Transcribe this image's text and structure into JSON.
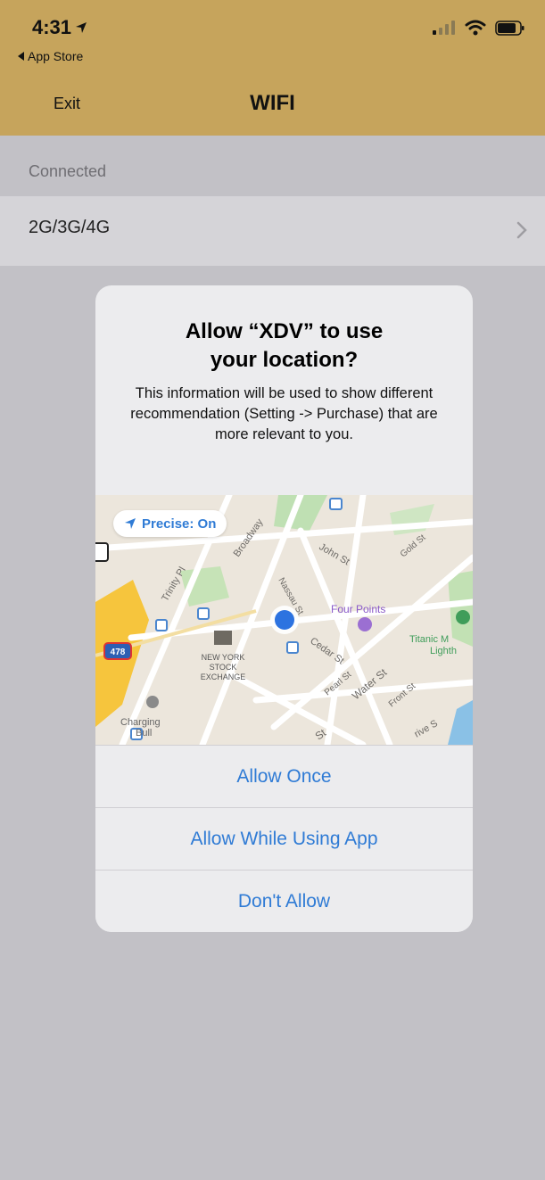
{
  "status_bar": {
    "time": "4:31",
    "back_app": "App Store"
  },
  "nav": {
    "exit_label": "Exit",
    "title": "WIFI"
  },
  "list": {
    "section_header": "Connected",
    "row_label": "2G/3G/4G"
  },
  "alert": {
    "title_line1": "Allow “XDV” to use",
    "title_line2": "your location?",
    "message": "This information will be used to show different recommendation (Setting -> Purchase) that are more relevant to you.",
    "map": {
      "precise_label": "Precise: On",
      "labels": {
        "broadway": "Broadway",
        "trinity": "Trinity Pl",
        "nassau": "Nassau St",
        "john": "John St",
        "gold": "Gold St",
        "four_points": "Four Points",
        "titanic": "Titanic M",
        "lighth": "Lighth",
        "cedar": "Cedar St",
        "pearl": "Pearl St",
        "water": "Water St",
        "front": "Front St",
        "nyse1": "NEW YORK",
        "nyse2": "STOCK",
        "nyse3": "EXCHANGE",
        "charging": "Charging",
        "bull": "Bull",
        "route": "478",
        "st": "St",
        "drive": "rive S"
      }
    },
    "buttons": {
      "once": "Allow Once",
      "while_using": "Allow While Using App",
      "dont": "Don't Allow"
    }
  },
  "colors": {
    "header_bg": "#c6a45c",
    "page_bg": "#c2c1c6",
    "alert_bg": "#ececee",
    "action_blue": "#2f7bd5"
  }
}
